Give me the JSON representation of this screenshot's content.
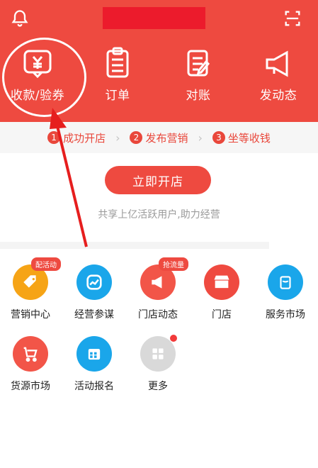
{
  "header": {
    "actions": [
      {
        "label": "收款/验券",
        "icon": "yuan-receipt-icon"
      },
      {
        "label": "订单",
        "icon": "clipboard-icon"
      },
      {
        "label": "对账",
        "icon": "edit-document-icon"
      },
      {
        "label": "发动态",
        "icon": "megaphone-icon"
      }
    ]
  },
  "steps": [
    {
      "num": "1",
      "label": "成功开店"
    },
    {
      "num": "2",
      "label": "发布营销"
    },
    {
      "num": "3",
      "label": "坐等收钱"
    }
  ],
  "cta": {
    "label": "立即开店"
  },
  "tagline": "共享上亿活跃用户,助力经营",
  "services": [
    {
      "label": "营销中心",
      "badge": "配活动",
      "icon": "tag-icon",
      "color": "#f6a416"
    },
    {
      "label": "经营参谋",
      "icon": "trend-icon",
      "color": "#1aa6ea"
    },
    {
      "label": "门店动态",
      "badge": "抢流量",
      "icon": "megaphone-icon",
      "color": "#f25548"
    },
    {
      "label": "门店",
      "icon": "store-icon",
      "color": "#ef4a40"
    },
    {
      "label": "服务市场",
      "icon": "shopping-bag-icon",
      "color": "#1aa6ea"
    },
    {
      "label": "货源市场",
      "icon": "cart-icon",
      "color": "#f25548"
    },
    {
      "label": "活动报名",
      "icon": "calendar-icon",
      "color": "#1aa6ea"
    },
    {
      "label": "更多",
      "icon": "grid-icon",
      "color": "#d9d9d9"
    }
  ],
  "colors": {
    "brand": "#ee4a40",
    "accent_blue": "#1aa6ea",
    "accent_orange": "#f6a416"
  }
}
